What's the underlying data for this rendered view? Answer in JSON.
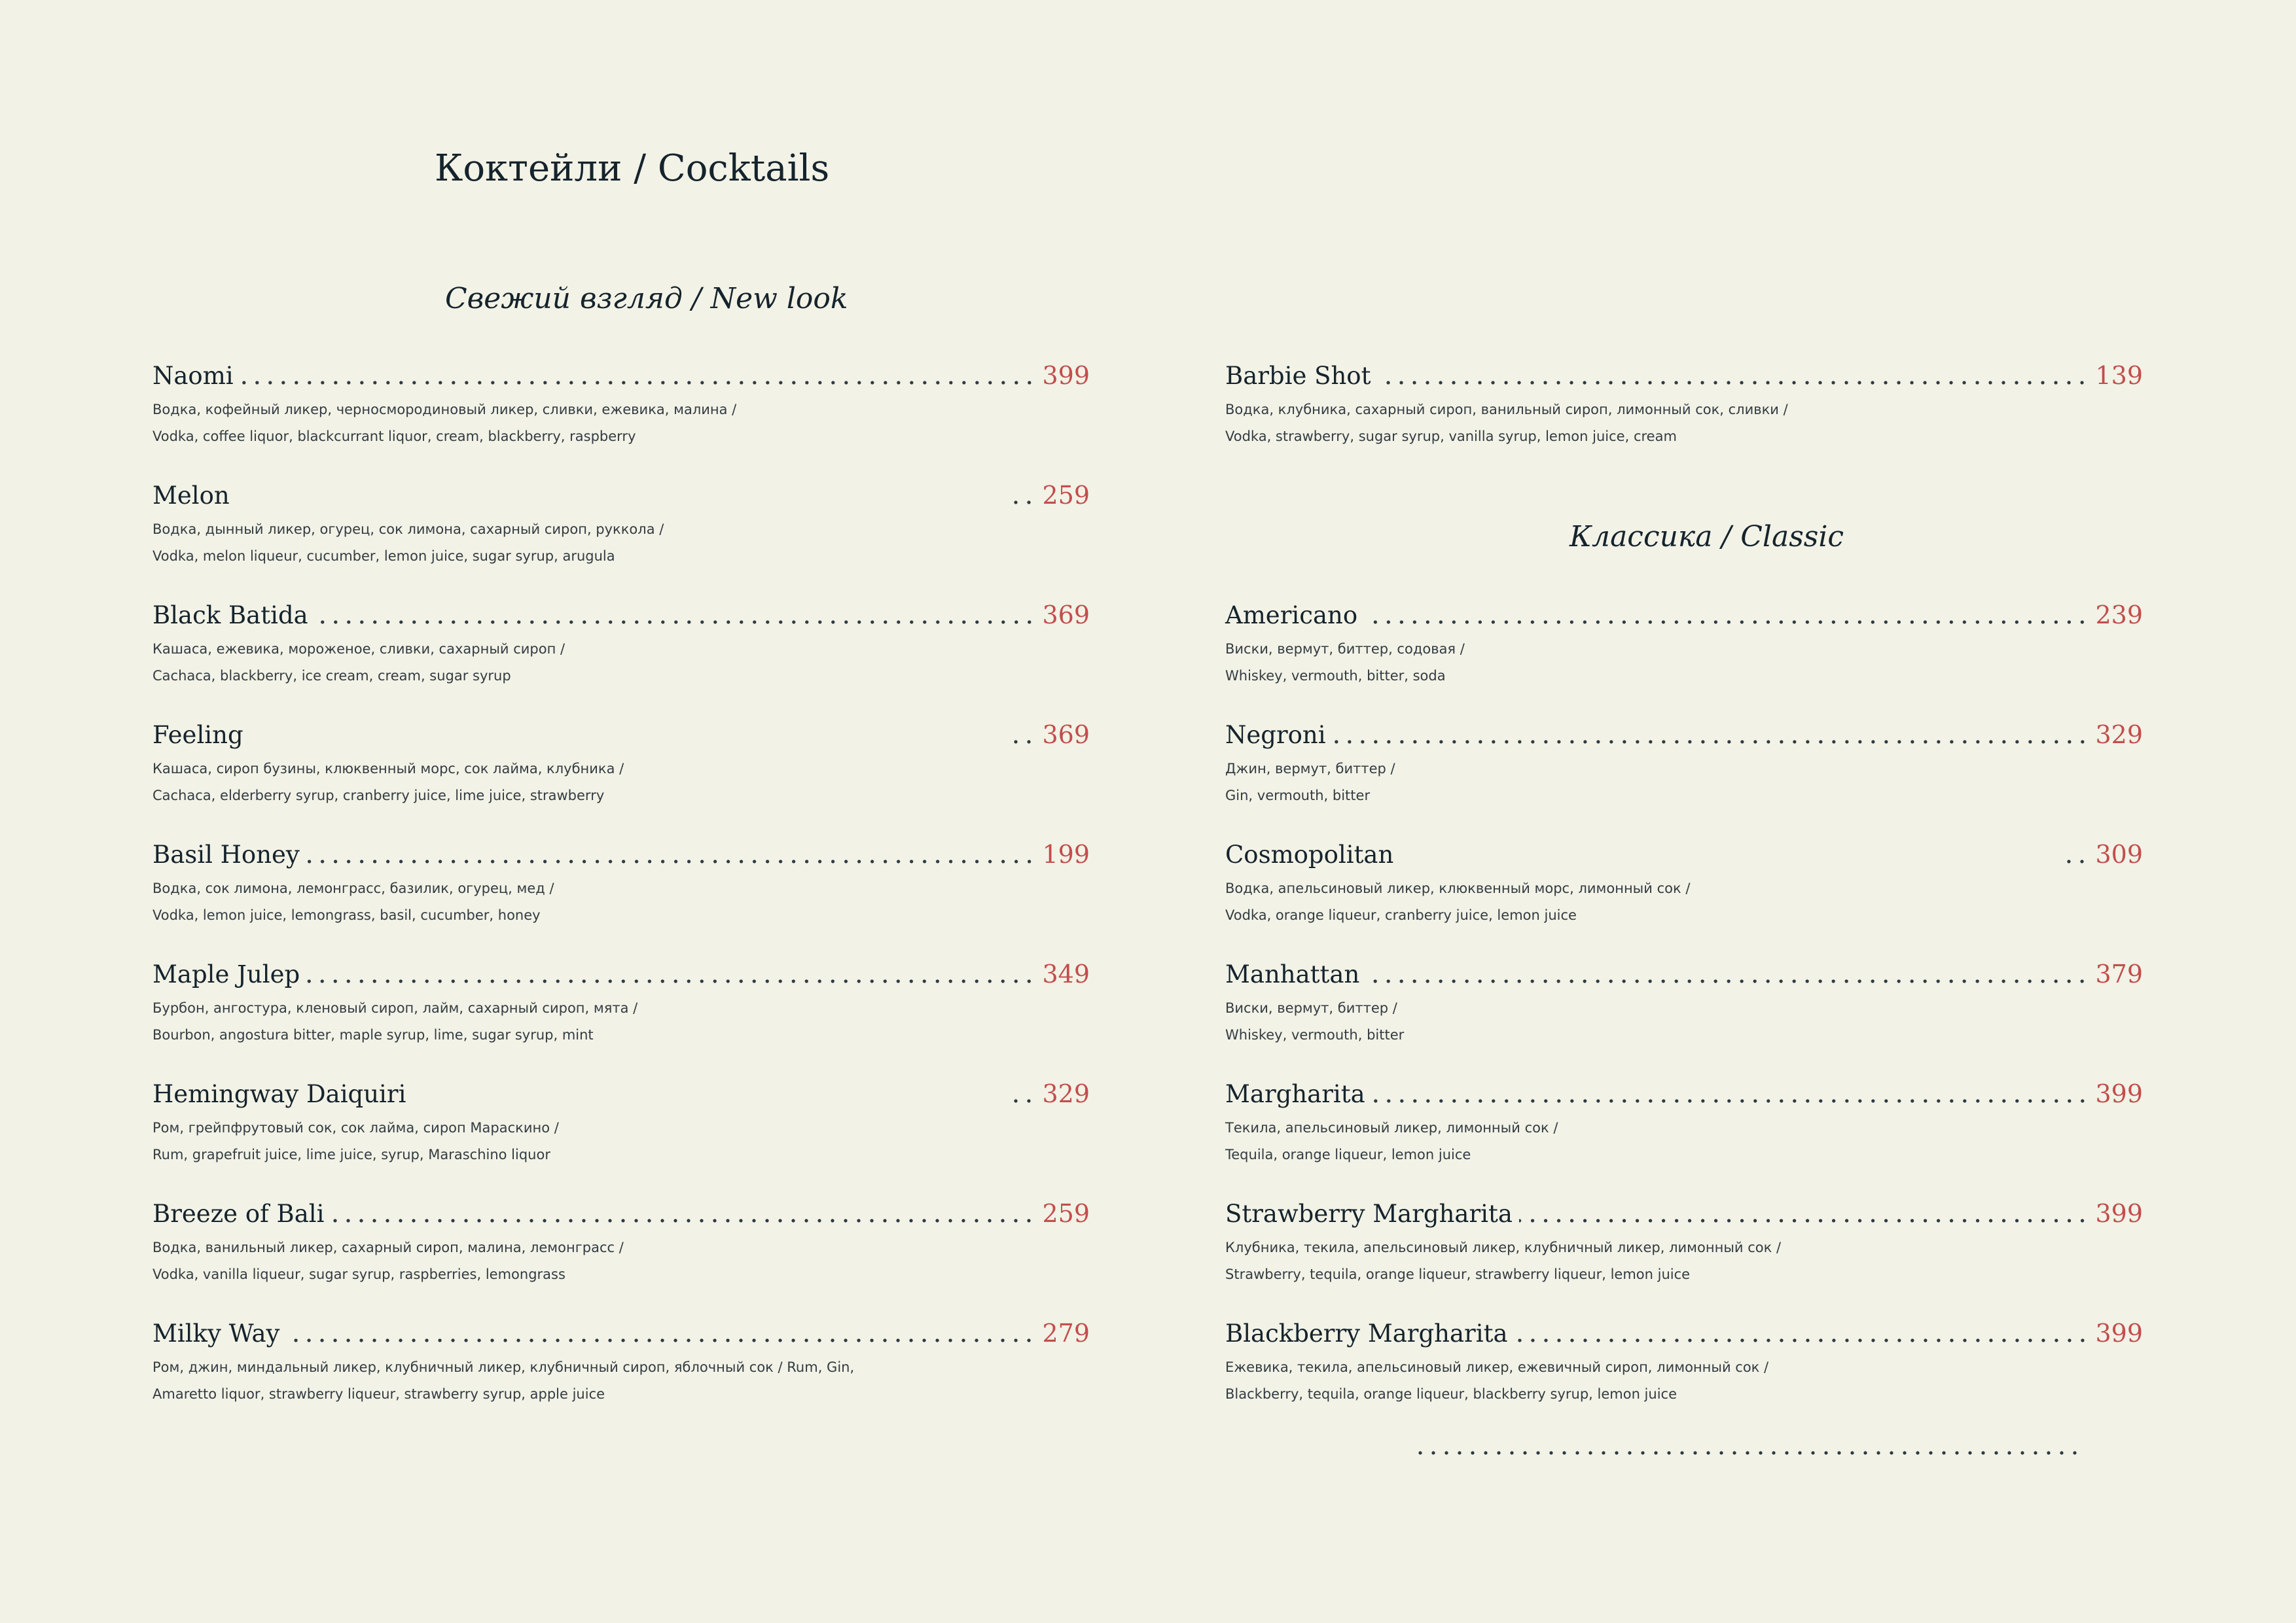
{
  "page": {
    "title": "Коктейли / Cocktails"
  },
  "sections": {
    "new_look": {
      "title": "Свежий взгляд / New look"
    },
    "classic": {
      "title": "Классика / Classic"
    }
  },
  "new_look_items": [
    {
      "name": "Naomi",
      "price": "399",
      "desc_ru": "Водка, кофейный ликер, черносмородиновый ликер, сливки, ежевика, малина /",
      "desc_en": "Vodka, coffee liquor, blackcurrant liquor, cream, blackberry, raspberry"
    },
    {
      "name": "Melon",
      "price": "259",
      "desc_ru": "Водка, дынный ликер, огурец, сок лимона, сахарный сироп, руккола /",
      "desc_en": "Vodka, melon liqueur, cucumber, lemon juice, sugar syrup, arugula"
    },
    {
      "name": "Black Batida",
      "price": "369",
      "desc_ru": "Кашаса, ежевика, мороженое, сливки, сахарный сироп /",
      "desc_en": "Cachaca, blackberry, ice cream, cream, sugar syrup"
    },
    {
      "name": "Feeling",
      "price": "369",
      "desc_ru": "Кашаса,  сироп бузины, клюквенный морс, сок лайма, клубника /",
      "desc_en": "Cachaca, elderberry syrup, cranberry juice, lime juice, strawberry"
    },
    {
      "name": "Basil Honey",
      "price": "199",
      "desc_ru": "Водка, сок лимона, лемонграсс, базилик, огурец, мед /",
      "desc_en": "Vodka, lemon juice, lemongrass, basil, cucumber, honey"
    },
    {
      "name": "Maple Julep",
      "price": "349",
      "desc_ru": "Бурбон, ангостура, кленовый сироп, лайм, сахарный сироп, мята /",
      "desc_en": "Bourbon, angostura bitter, maple syrup, lime, sugar syrup, mint"
    },
    {
      "name": "Hemingway Daiquiri",
      "price": "329",
      "desc_ru": "Ром, грейпфрутовый сок, сок лайма, сироп Мараскино  /",
      "desc_en": "Rum, grapefruit juice, lime juice, syrup, Maraschino liquor"
    },
    {
      "name": "Breeze of Bali",
      "price": "259",
      "desc_ru": "Водка, ванильный ликер, сахарный сироп, малина, лемонграсс /",
      "desc_en": "Vodka, vanilla liqueur, sugar syrup, raspberries, lemongrass"
    },
    {
      "name": "Milky Way",
      "price": "279",
      "desc_ru": "Ром, джин, миндальный ликер, клубничный ликер, клубничный сироп, яблочный сок / Rum, Gin,",
      "desc_en": "Amaretto liquor, strawberry liqueur, strawberry syrup, apple juice"
    }
  ],
  "right_items": [
    {
      "name": "Barbie Shot",
      "price": "139",
      "desc_ru": "Водка, клубника, сахарный сироп, ванильный сироп, лимонный сок, сливки /",
      "desc_en": "Vodka, strawberry, sugar syrup, vanilla syrup, lemon juice, cream"
    },
    {
      "name": "Americano",
      "price": "239",
      "desc_ru": "Виски, вермут, биттер, содовая /",
      "desc_en": "Whiskey, vermouth, bitter, soda"
    },
    {
      "name": "Negroni",
      "price": "329",
      "desc_ru": "Джин, вермут, биттер /",
      "desc_en": "Gin, vermouth, bitter"
    },
    {
      "name": "Cosmopolitan",
      "price": "309",
      "desc_ru": "Водка, апельсиновый ликер, клюквенный морс, лимонный сок /",
      "desc_en": "Vodka, orange liqueur, cranberry juice, lemon juice"
    },
    {
      "name": "Manhattan",
      "price": "379",
      "desc_ru": "Виски, вермут, биттер /",
      "desc_en": "Whiskey, vermouth, bitter"
    },
    {
      "name": "Margharita",
      "price": "399",
      "desc_ru": "Текила, апельсиновый ликер, лимонный сок /",
      "desc_en": "Tequila, orange liqueur, lemon juice"
    },
    {
      "name": "Strawberry Margharita",
      "price": "399",
      "desc_ru": "Клубника, текила, апельсиновый ликер, клубничный ликер, лимонный сок /",
      "desc_en": "Strawberry, tequila, orange liqueur, strawberry liqueur, lemon juice"
    },
    {
      "name": "Blackberry Margharita",
      "price": "399",
      "desc_ru": "Ежевика, текила, апельсиновый ликер, ежевичный сироп, лимонный сок /",
      "desc_en": "Blackberry, tequila, orange liqueur, blackberry syrup, lemon juice"
    }
  ],
  "colors": {
    "background": "#f2f2e6",
    "text": "#15232c",
    "price": "#c24e4c"
  }
}
